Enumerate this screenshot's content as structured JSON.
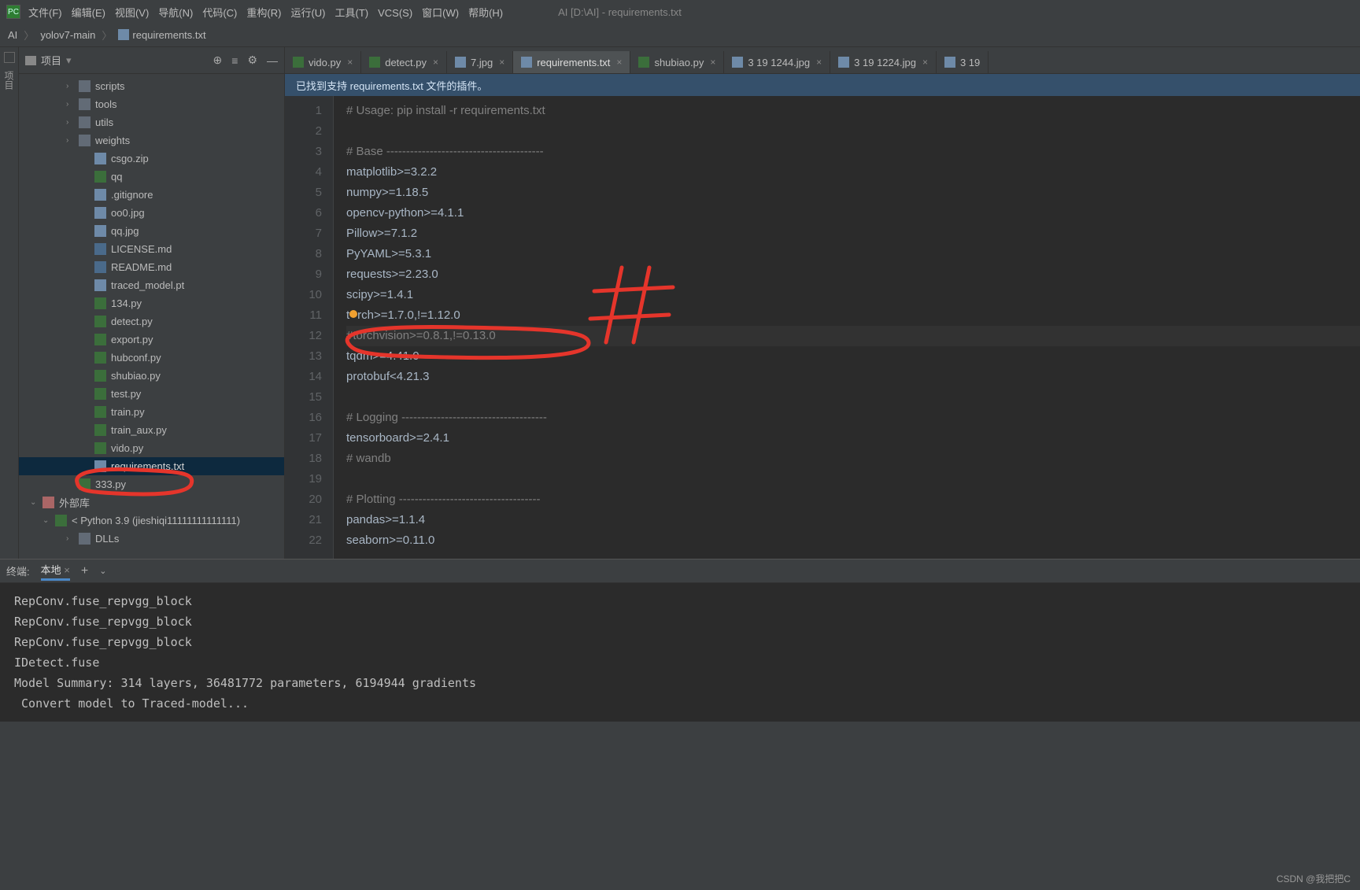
{
  "window_title": "AI [D:\\AI] - requirements.txt",
  "menu": [
    "文件(F)",
    "编辑(E)",
    "视图(V)",
    "导航(N)",
    "代码(C)",
    "重构(R)",
    "运行(U)",
    "工具(T)",
    "VCS(S)",
    "窗口(W)",
    "帮助(H)"
  ],
  "breadcrumb": {
    "root": "AI",
    "project": "yolov7-main",
    "file": "requirements.txt"
  },
  "sidebar": {
    "title": "项目",
    "tools": {
      "target": "⊕",
      "collapse": "≡",
      "split": "|",
      "gear": "⚙",
      "hide": "—"
    },
    "items": [
      {
        "depth": "d1",
        "chev": "›",
        "ic": "folder",
        "label": "scripts"
      },
      {
        "depth": "d1",
        "chev": "›",
        "ic": "folder",
        "label": "tools"
      },
      {
        "depth": "d1",
        "chev": "›",
        "ic": "folder",
        "label": "utils"
      },
      {
        "depth": "d1",
        "chev": "›",
        "ic": "folder",
        "label": "weights"
      },
      {
        "depth": "d2",
        "chev": "",
        "ic": "zip",
        "label": "csgo.zip"
      },
      {
        "depth": "d2",
        "chev": "",
        "ic": "py",
        "label": "qq"
      },
      {
        "depth": "d2",
        "chev": "",
        "ic": "txt",
        "label": ".gitignore"
      },
      {
        "depth": "d2",
        "chev": "",
        "ic": "img",
        "label": "oo0.jpg"
      },
      {
        "depth": "d2",
        "chev": "",
        "ic": "img",
        "label": "qq.jpg"
      },
      {
        "depth": "d2",
        "chev": "",
        "ic": "md",
        "label": "LICENSE.md"
      },
      {
        "depth": "d2",
        "chev": "",
        "ic": "md",
        "label": "README.md"
      },
      {
        "depth": "d2",
        "chev": "",
        "ic": "txt",
        "label": "traced_model.pt"
      },
      {
        "depth": "d2",
        "chev": "",
        "ic": "py",
        "label": "134.py"
      },
      {
        "depth": "d2",
        "chev": "",
        "ic": "py",
        "label": "detect.py"
      },
      {
        "depth": "d2",
        "chev": "",
        "ic": "py",
        "label": "export.py"
      },
      {
        "depth": "d2",
        "chev": "",
        "ic": "py",
        "label": "hubconf.py"
      },
      {
        "depth": "d2",
        "chev": "",
        "ic": "py",
        "label": "shubiao.py"
      },
      {
        "depth": "d2",
        "chev": "",
        "ic": "py",
        "label": "test.py"
      },
      {
        "depth": "d2",
        "chev": "",
        "ic": "py",
        "label": "train.py"
      },
      {
        "depth": "d2",
        "chev": "",
        "ic": "py",
        "label": "train_aux.py"
      },
      {
        "depth": "d2",
        "chev": "",
        "ic": "py",
        "label": "vido.py"
      },
      {
        "depth": "d2",
        "chev": "",
        "ic": "txt",
        "label": "requirements.txt",
        "selected": true
      },
      {
        "depth": "d1",
        "chev": "",
        "ic": "py",
        "label": "333.py"
      },
      {
        "depth": "dm1",
        "chev": "⌄",
        "ic": "lib",
        "label": "外部库"
      },
      {
        "depth": "d0",
        "chev": "⌄",
        "ic": "py",
        "label": "< Python 3.9 (jieshiqi11111111111111)"
      },
      {
        "depth": "d1",
        "chev": "›",
        "ic": "folder",
        "label": "DLLs"
      }
    ]
  },
  "tabs": [
    {
      "ic": "py",
      "label": "vido.py",
      "close": "×"
    },
    {
      "ic": "py",
      "label": "detect.py",
      "close": "×"
    },
    {
      "ic": "img",
      "label": "7.jpg",
      "close": "×"
    },
    {
      "ic": "txt",
      "label": "requirements.txt",
      "close": "×",
      "active": true
    },
    {
      "ic": "py",
      "label": "shubiao.py",
      "close": "×"
    },
    {
      "ic": "img",
      "label": "3 19 1244.jpg",
      "close": "×"
    },
    {
      "ic": "img",
      "label": "3 19 1224.jpg",
      "close": "×"
    },
    {
      "ic": "img",
      "label": "3 19",
      "close": ""
    }
  ],
  "banner": "已找到支持 requirements.txt 文件的插件。",
  "code": {
    "lines": [
      {
        "n": "1",
        "t": "# Usage: pip install -r requirements.txt",
        "cls": "comment"
      },
      {
        "n": "2",
        "t": "",
        "cls": ""
      },
      {
        "n": "3",
        "t": "# Base ----------------------------------------",
        "cls": "comment"
      },
      {
        "n": "4",
        "t": "matplotlib>=3.2.2",
        "cls": ""
      },
      {
        "n": "5",
        "t": "numpy>=1.18.5",
        "cls": ""
      },
      {
        "n": "6",
        "t": "opencv-python>=4.1.1",
        "cls": ""
      },
      {
        "n": "7",
        "t": "Pillow>=7.1.2",
        "cls": ""
      },
      {
        "n": "8",
        "t": "PyYAML>=5.3.1",
        "cls": ""
      },
      {
        "n": "9",
        "t": "requests>=2.23.0",
        "cls": ""
      },
      {
        "n": "10",
        "t": "scipy>=1.4.1",
        "cls": ""
      },
      {
        "n": "11",
        "t": "t🟡rch>=1.7.0,!=1.12.0",
        "cls": "",
        "dot": true
      },
      {
        "n": "12",
        "t": "#torchvision>=0.8.1,!=0.13.0",
        "cls": "comment hl"
      },
      {
        "n": "13",
        "t": "tqdm>=4.41.0",
        "cls": ""
      },
      {
        "n": "14",
        "t": "protobuf<4.21.3",
        "cls": ""
      },
      {
        "n": "15",
        "t": "",
        "cls": ""
      },
      {
        "n": "16",
        "t": "# Logging -------------------------------------",
        "cls": "comment"
      },
      {
        "n": "17",
        "t": "tensorboard>=2.4.1",
        "cls": ""
      },
      {
        "n": "18",
        "t": "# wandb",
        "cls": "comment"
      },
      {
        "n": "19",
        "t": "",
        "cls": ""
      },
      {
        "n": "20",
        "t": "# Plotting ------------------------------------",
        "cls": "comment"
      },
      {
        "n": "21",
        "t": "pandas>=1.1.4",
        "cls": ""
      },
      {
        "n": "22",
        "t": "seaborn>=0.11.0",
        "cls": ""
      }
    ]
  },
  "terminal": {
    "title": "终端:",
    "tab": "本地",
    "lines": [
      "RepConv.fuse_repvgg_block",
      "RepConv.fuse_repvgg_block",
      "RepConv.fuse_repvgg_block",
      "IDetect.fuse",
      "Model Summary: 314 layers, 36481772 parameters, 6194944 gradients",
      " Convert model to Traced-model..."
    ]
  },
  "left_strip": {
    "label": "项目"
  },
  "watermark": "CSDN @我把把C"
}
